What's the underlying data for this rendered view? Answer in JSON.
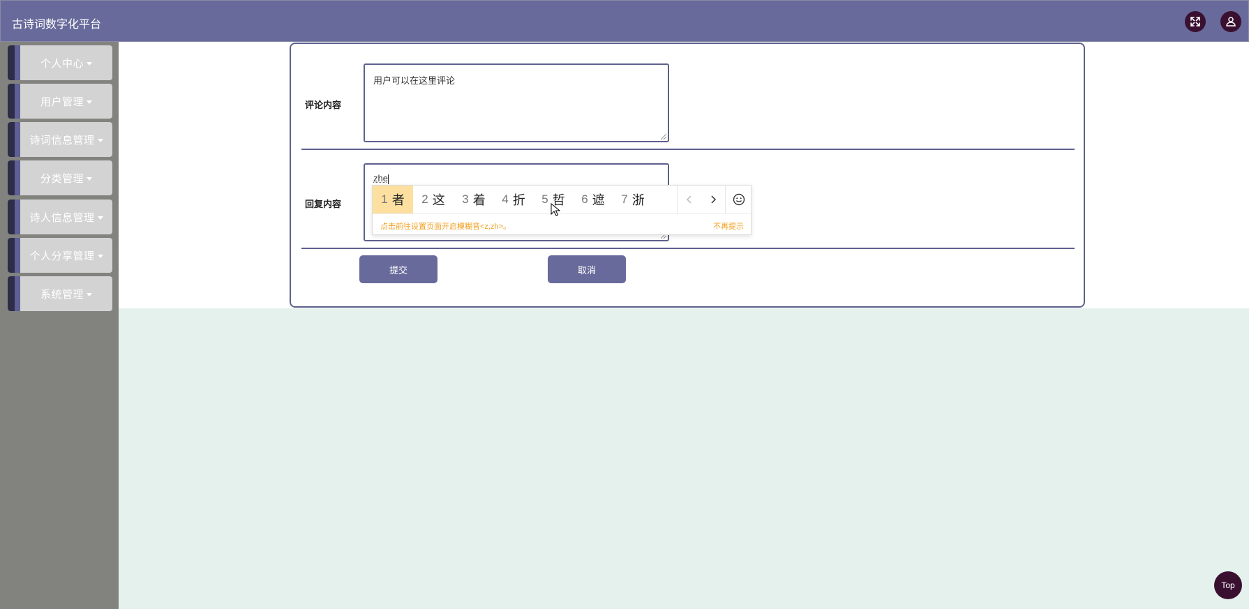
{
  "header": {
    "title": "古诗词数字化平台",
    "fullscreen_icon": "fullscreen-expand-icon",
    "user_icon": "user-icon",
    "bg_color": "#676a9a"
  },
  "sidebar": {
    "items": [
      {
        "label": "个人中心"
      },
      {
        "label": "用户管理"
      },
      {
        "label": "诗词信息管理"
      },
      {
        "label": "分类管理"
      },
      {
        "label": "诗人信息管理"
      },
      {
        "label": "个人分享管理"
      },
      {
        "label": "系统管理"
      }
    ]
  },
  "form": {
    "comment_label": "评论内容",
    "comment_value": "用户可以在这里评论",
    "reply_label": "回复内容",
    "reply_value": "zhe",
    "submit_label": "提交",
    "cancel_label": "取消"
  },
  "ime": {
    "candidates": [
      {
        "num": "1",
        "char": "者"
      },
      {
        "num": "2",
        "char": "这"
      },
      {
        "num": "3",
        "char": "着"
      },
      {
        "num": "4",
        "char": "折"
      },
      {
        "num": "5",
        "char": "哲"
      },
      {
        "num": "6",
        "char": "遮"
      },
      {
        "num": "7",
        "char": "浙"
      }
    ],
    "hint": "点击前往设置页面开启模糊音<z,zh>。",
    "dismiss": "不再提示",
    "prev_icon": "chevron-left-icon",
    "next_icon": "chevron-right-icon",
    "emoji_icon": "smiley-icon"
  },
  "top_button": {
    "label": "Top"
  }
}
